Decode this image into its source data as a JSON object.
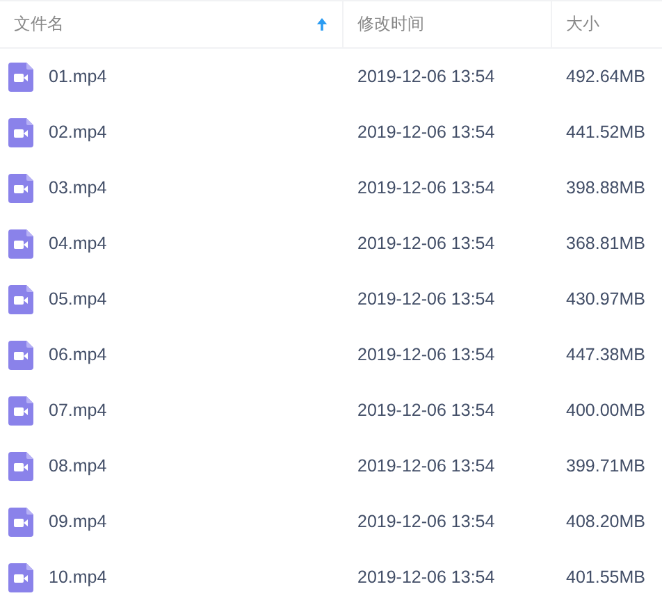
{
  "table": {
    "columns": [
      {
        "label": "文件名",
        "sorted": true
      },
      {
        "label": "修改时间",
        "sorted": false
      },
      {
        "label": "大小",
        "sorted": false
      }
    ],
    "rows": [
      {
        "name": "01.mp4",
        "modified": "2019-12-06 13:54",
        "size": "492.64MB"
      },
      {
        "name": "02.mp4",
        "modified": "2019-12-06 13:54",
        "size": "441.52MB"
      },
      {
        "name": "03.mp4",
        "modified": "2019-12-06 13:54",
        "size": "398.88MB"
      },
      {
        "name": "04.mp4",
        "modified": "2019-12-06 13:54",
        "size": "368.81MB"
      },
      {
        "name": "05.mp4",
        "modified": "2019-12-06 13:54",
        "size": "430.97MB"
      },
      {
        "name": "06.mp4",
        "modified": "2019-12-06 13:54",
        "size": "447.38MB"
      },
      {
        "name": "07.mp4",
        "modified": "2019-12-06 13:54",
        "size": "400.00MB"
      },
      {
        "name": "08.mp4",
        "modified": "2019-12-06 13:54",
        "size": "399.71MB"
      },
      {
        "name": "09.mp4",
        "modified": "2019-12-06 13:54",
        "size": "408.20MB"
      },
      {
        "name": "10.mp4",
        "modified": "2019-12-06 13:54",
        "size": "401.55MB"
      }
    ]
  }
}
